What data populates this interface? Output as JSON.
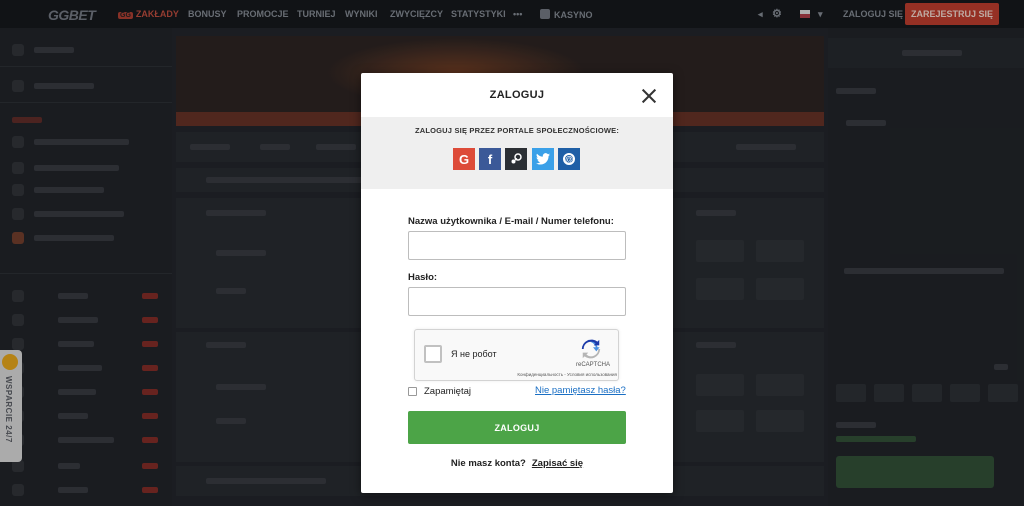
{
  "topnav": {
    "logo": "GGBET",
    "items": [
      {
        "label": "ZAKŁADY",
        "active": true
      },
      {
        "label": "BONUSY"
      },
      {
        "label": "PROMOCJE"
      },
      {
        "label": "TURNIEJ"
      },
      {
        "label": "WYNIKI"
      },
      {
        "label": "ZWYCIĘZCY"
      },
      {
        "label": "STATYSTYKI"
      },
      {
        "label": "•••"
      },
      {
        "label": "KASYNO"
      }
    ],
    "login": "ZALOGUJ SIĘ",
    "register": "ZAREJESTRUJ SIĘ"
  },
  "sidebar": {
    "support_label": "WSPARCIE 24/7"
  },
  "modal": {
    "title": "ZALOGUJ",
    "social_title": "ZALOGUJ SIĘ PRZEZ PORTALE SPOŁECZNOŚCIOWE:",
    "social": [
      {
        "name": "google-icon",
        "glyph": "G"
      },
      {
        "name": "facebook-icon",
        "glyph": "f"
      },
      {
        "name": "steam-icon",
        "glyph": "⟲"
      },
      {
        "name": "twitter-icon",
        "glyph": "🐦"
      },
      {
        "name": "mailru-icon",
        "glyph": "@"
      }
    ],
    "username_label": "Nazwa użytkownika / E-mail / Numer telefonu:",
    "username_value": "",
    "password_label": "Hasło:",
    "password_value": "",
    "captcha": {
      "text": "Я не робот",
      "brand": "reCAPTCHA",
      "links": "Конфиденциальность - Условия использования"
    },
    "remember_label": "Zapamiętaj",
    "forgot_label": "Nie pamiętasz hasła?",
    "submit_label": "ZALOGUJ",
    "no_account": "Nie masz konta?",
    "signup": "Zapisać się"
  },
  "colors": {
    "accent_red": "#b0392b",
    "submit_green": "#4ca447",
    "link_blue": "#1a6fc4"
  }
}
